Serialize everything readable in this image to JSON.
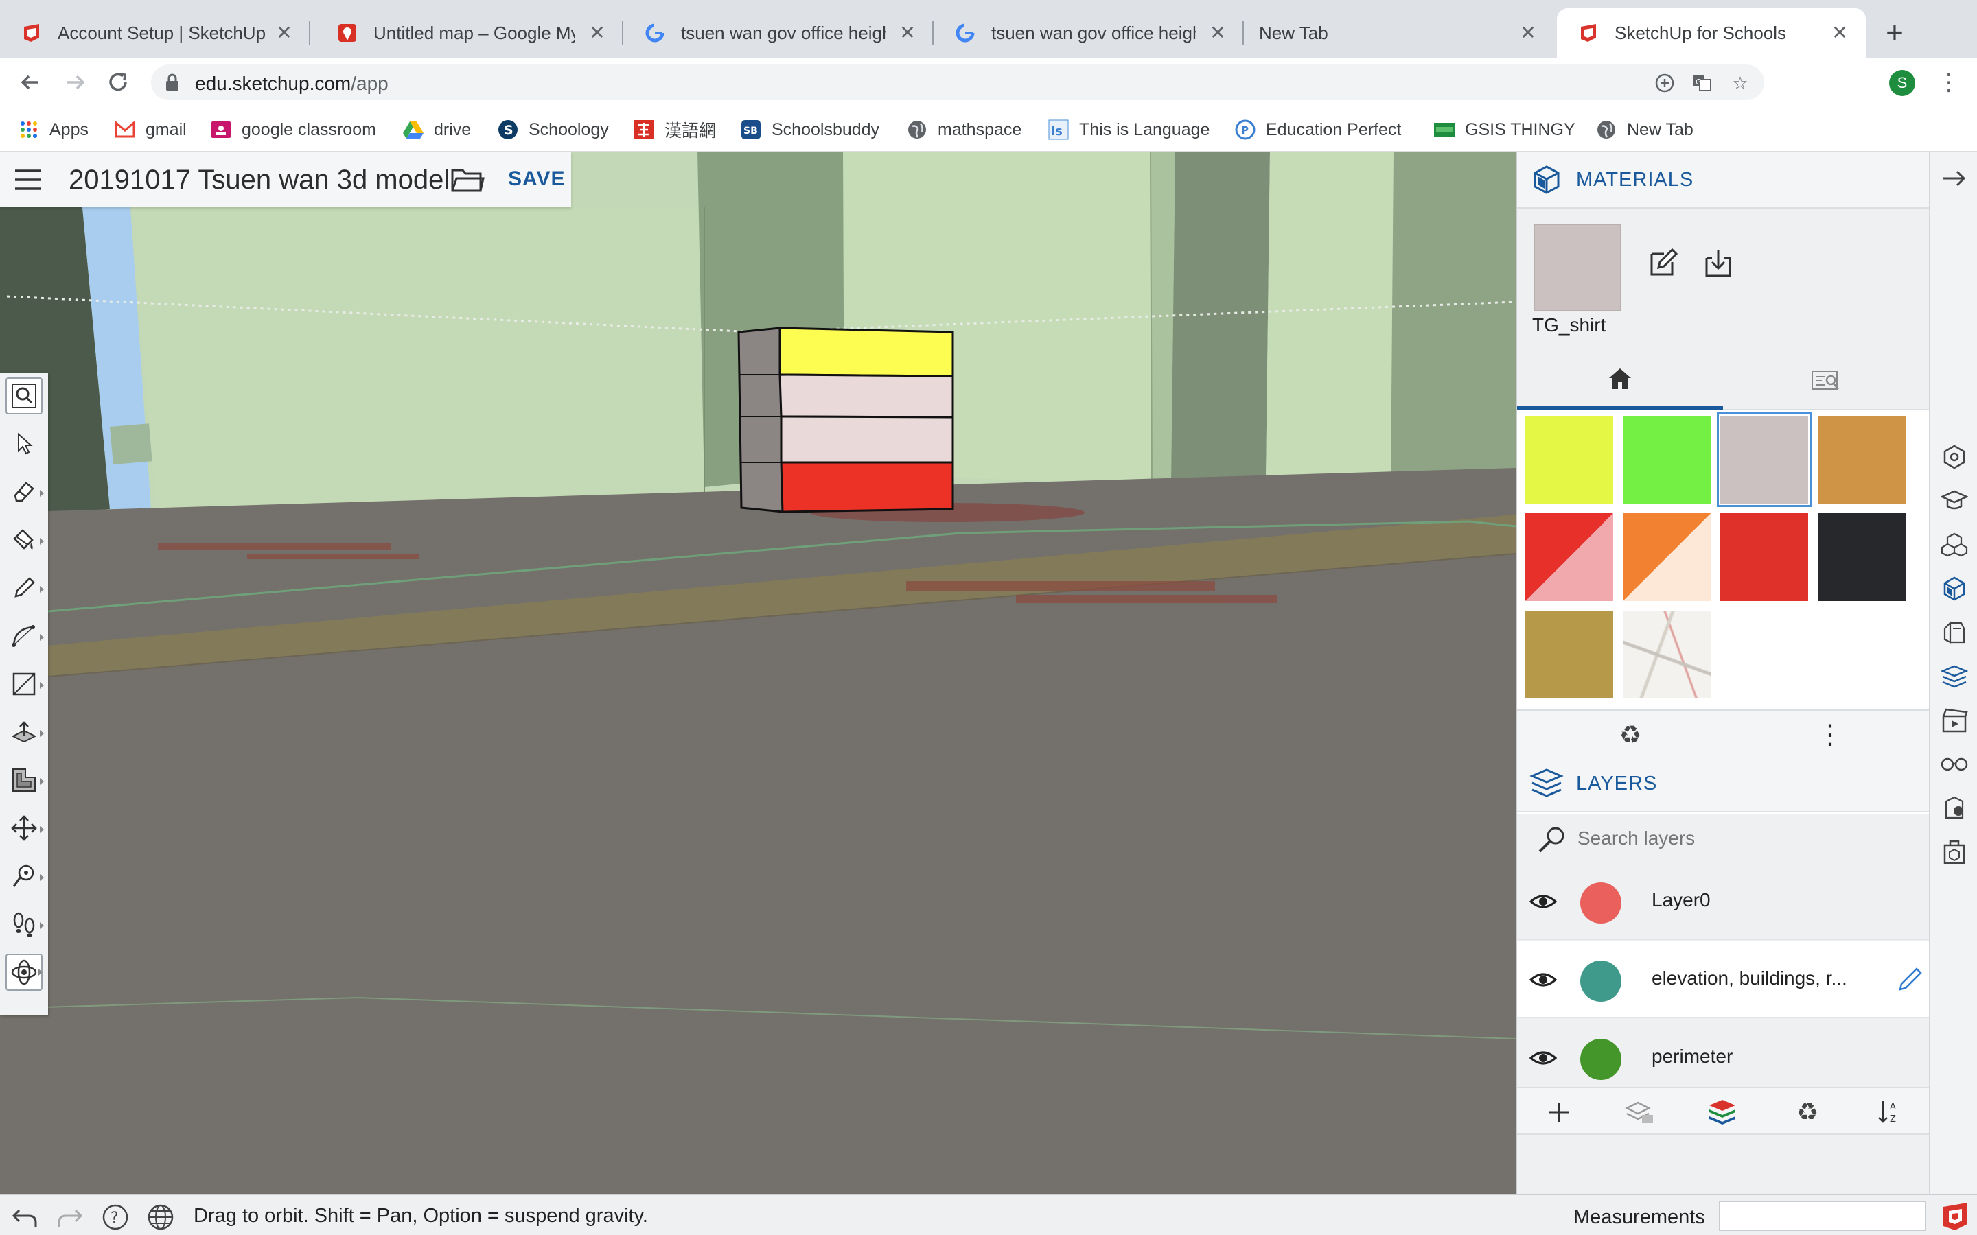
{
  "browser": {
    "tabs": [
      {
        "title": "Account Setup | SketchUp",
        "favicon": "sketchup-icon",
        "active": false
      },
      {
        "title": "Untitled map – Google My Maps",
        "favicon": "maps-pin-icon",
        "active": false
      },
      {
        "title": "tsuen wan gov office height - Google Search",
        "favicon": "google-icon",
        "active": false
      },
      {
        "title": "tsuen wan gov office height - Google Search",
        "favicon": "google-icon",
        "active": false
      },
      {
        "title": "New Tab",
        "favicon": "",
        "active": false
      },
      {
        "title": "SketchUp for Schools",
        "favicon": "sketchup-icon",
        "active": true
      }
    ],
    "new_tab_symbol": "+",
    "url_host": "edu.sketchup.com",
    "url_path": "/app",
    "profile_initial": "S",
    "bookmarks": [
      {
        "label": "Apps",
        "icon": "apps-grid-icon"
      },
      {
        "label": "gmail",
        "icon": "gmail-icon"
      },
      {
        "label": "google classroom",
        "icon": "classroom-icon"
      },
      {
        "label": "drive",
        "icon": "drive-icon"
      },
      {
        "label": "Schoology",
        "icon": "schoology-icon"
      },
      {
        "label": "漢語網",
        "icon": "hanyu-icon"
      },
      {
        "label": "Schoolsbuddy",
        "icon": "schoolsbuddy-icon"
      },
      {
        "label": "mathspace",
        "icon": "globe-icon"
      },
      {
        "label": "This is Language",
        "icon": "til-icon"
      },
      {
        "label": "Education Perfect",
        "icon": "ep-icon"
      },
      {
        "label": "GSIS THINGY",
        "icon": "gsis-icon"
      },
      {
        "label": "New Tab",
        "icon": "globe-icon"
      }
    ]
  },
  "app": {
    "doc_title": "20191017 Tsuen wan 3d model",
    "save_label": "SAVE",
    "tools": [
      "search-tool",
      "select-tool",
      "eraser-tool",
      "paint-bucket-tool",
      "pencil-tool",
      "arc-tool",
      "rectangle-tool",
      "push-pull-tool",
      "offset-tool",
      "move-tool",
      "tape-measure-tool",
      "walk-tool",
      "orbit-tool"
    ],
    "selected_tool": "search-tool"
  },
  "materials": {
    "heading": "MATERIALS",
    "current_name": "TG_shirt",
    "current_color": "#cbc1c0",
    "swatches": [
      {
        "color": "#e4f744"
      },
      {
        "color": "#73f043"
      },
      {
        "color": "#cbc1c0",
        "selected": true
      },
      {
        "color": "#d09446"
      },
      {
        "color": "#e8302a",
        "color2": "#f2a9ae"
      },
      {
        "color": "#f28231",
        "color2": "#fde8d8"
      },
      {
        "color": "#e0302a"
      },
      {
        "color": "#27282c"
      },
      {
        "color": "#b7994a"
      },
      {
        "color": "#f4f2ee",
        "image": "map-texture"
      }
    ]
  },
  "layers": {
    "heading": "LAYERS",
    "search_placeholder": "Search layers",
    "items": [
      {
        "name": "Layer0",
        "color": "#e9605d",
        "visible": true,
        "active": false
      },
      {
        "name": "elevation, buildings, r...",
        "color": "#3f9a8c",
        "visible": true,
        "active": true
      },
      {
        "name": "perimeter",
        "color": "#45962a",
        "visible": true,
        "active": false
      }
    ]
  },
  "status": {
    "hint": "Drag to orbit. Shift = Pan, Option = suspend gravity.",
    "measurements_label": "Measurements",
    "measurements_value": ""
  },
  "colors": {
    "accent": "#1a5a9c",
    "panel_bg": "#eef0f2"
  }
}
